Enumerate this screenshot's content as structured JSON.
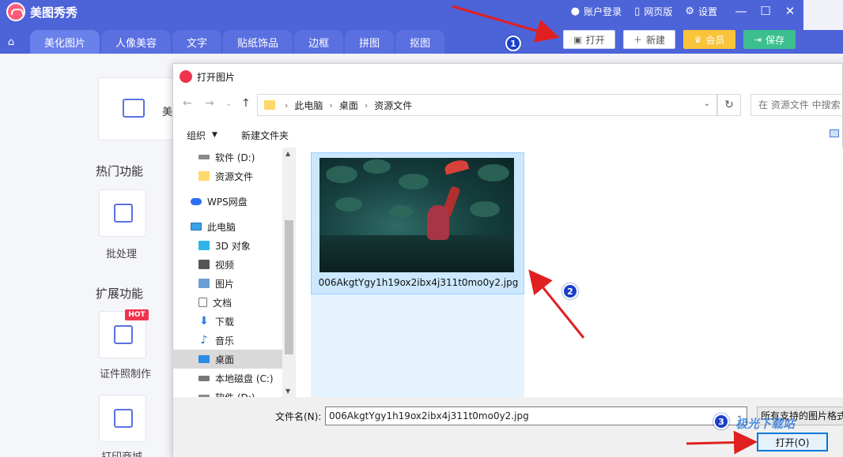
{
  "app": {
    "title": "美图秀秀",
    "top_links": {
      "account": "账户登录",
      "web": "网页版",
      "settings": "设置"
    },
    "tabs": [
      "美化图片",
      "人像美容",
      "文字",
      "贴纸饰品",
      "边框",
      "拼图",
      "抠图"
    ],
    "buttons": {
      "open": "打开",
      "new": "新建",
      "vip": "会员",
      "save": "保存"
    },
    "colors": {
      "header": "#4d63d8",
      "vip": "#f9c33a",
      "save": "#3cbf8f"
    }
  },
  "left_panel": {
    "big_card_label": "美",
    "hot_section": "热门功能",
    "batch_label": "批处理",
    "ext_section": "扩展功能",
    "hot_badge": "HOT",
    "id_photo_label": "证件照制作",
    "print_label": "打印商城"
  },
  "dialog": {
    "title": "打开图片",
    "breadcrumbs": [
      "此电脑",
      "桌面",
      "资源文件"
    ],
    "search_placeholder": "在 资源文件 中搜索",
    "toolbar": {
      "organize": "组织",
      "new_folder": "新建文件夹"
    },
    "nav_items": [
      {
        "label": "软件 (D:)",
        "icon": "drive-icon"
      },
      {
        "label": "资源文件",
        "icon": "folder-icon"
      },
      {
        "label": "WPS网盘",
        "icon": "cloud-icon"
      },
      {
        "label": "此电脑",
        "icon": "computer-icon"
      },
      {
        "label": "3D 对象",
        "icon": "3d-icon"
      },
      {
        "label": "视频",
        "icon": "video-icon"
      },
      {
        "label": "图片",
        "icon": "picture-icon"
      },
      {
        "label": "文档",
        "icon": "document-icon"
      },
      {
        "label": "下载",
        "icon": "download-icon"
      },
      {
        "label": "音乐",
        "icon": "music-icon"
      },
      {
        "label": "桌面",
        "icon": "desktop-icon"
      },
      {
        "label": "本地磁盘 (C:)",
        "icon": "disk-icon"
      },
      {
        "label": "软件 (D:)",
        "icon": "drive-icon"
      }
    ],
    "selected_nav": "桌面",
    "file": {
      "name": "006AkgtYgy1h19ox2ibx4j311t0mo0y2.jpg"
    },
    "filename_label": "文件名(N):",
    "filename_value": "006AkgtYgy1h19ox2ibx4j311t0mo0y2.jpg",
    "filter": "所有支持的图片格式",
    "open_button": "打开(O)"
  },
  "annotations": {
    "steps": [
      "1",
      "2",
      "3"
    ],
    "color": "#e02020"
  },
  "watermark": "极光下载站"
}
